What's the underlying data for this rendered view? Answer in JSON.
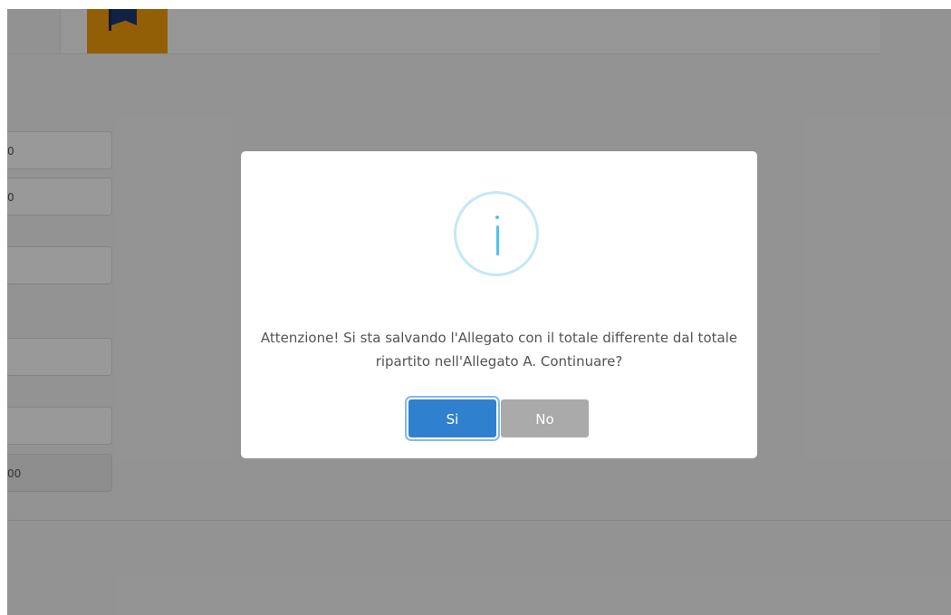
{
  "background": {
    "fields": [
      {
        "name": "field-1",
        "value": "0"
      },
      {
        "name": "field-2",
        "value": "0"
      },
      {
        "name": "field-3",
        "value": ""
      },
      {
        "name": "field-4",
        "value": ""
      },
      {
        "name": "field-5",
        "value": ""
      },
      {
        "name": "field-6",
        "value": "00"
      }
    ],
    "flag_icon": "flag-icon"
  },
  "dialog": {
    "icon": "info-icon",
    "icon_color": "#4fc3ee",
    "message": "Attenzione! Si sta salvando l'Allegato con il totale differente dal totale ripartito nell'Allegato A. Continuare?",
    "confirm_label": "Si",
    "cancel_label": "No",
    "confirm_color": "#3080d0",
    "cancel_color": "#aaaaaa"
  }
}
